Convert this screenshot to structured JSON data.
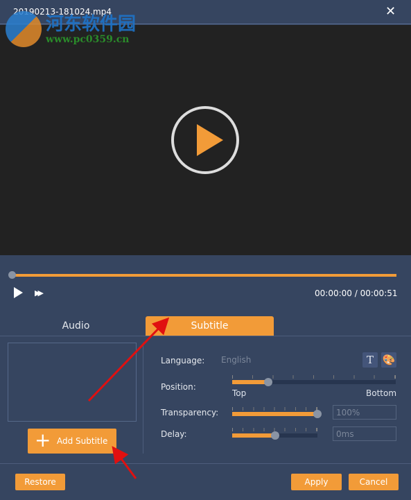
{
  "window": {
    "title": "20190213-181024.mp4",
    "close_icon": "close-icon"
  },
  "watermark": {
    "name": "河东软件园",
    "url": "www.pc0359.cn"
  },
  "player": {
    "current_time": "00:00:00",
    "separator": "/",
    "duration": "00:00:51",
    "progress": 0
  },
  "tabs": [
    {
      "label": "Audio",
      "active": false
    },
    {
      "label": "Subtitle",
      "active": true
    }
  ],
  "subtitle": {
    "add_label": "Add Subtitle",
    "language_label": "Language:",
    "language_value": "English",
    "position_label": "Position:",
    "position_top": "Top",
    "position_bottom": "Bottom",
    "position_value": 0.22,
    "transparency_label": "Transparency:",
    "transparency_value": "100%",
    "transparency_level": 1.0,
    "delay_label": "Delay:",
    "delay_value": "0ms",
    "delay_level": 0.5
  },
  "footer": {
    "restore": "Restore",
    "apply": "Apply",
    "cancel": "Cancel"
  },
  "colors": {
    "accent": "#f29b38",
    "panel": "#364560",
    "video": "#222222"
  }
}
